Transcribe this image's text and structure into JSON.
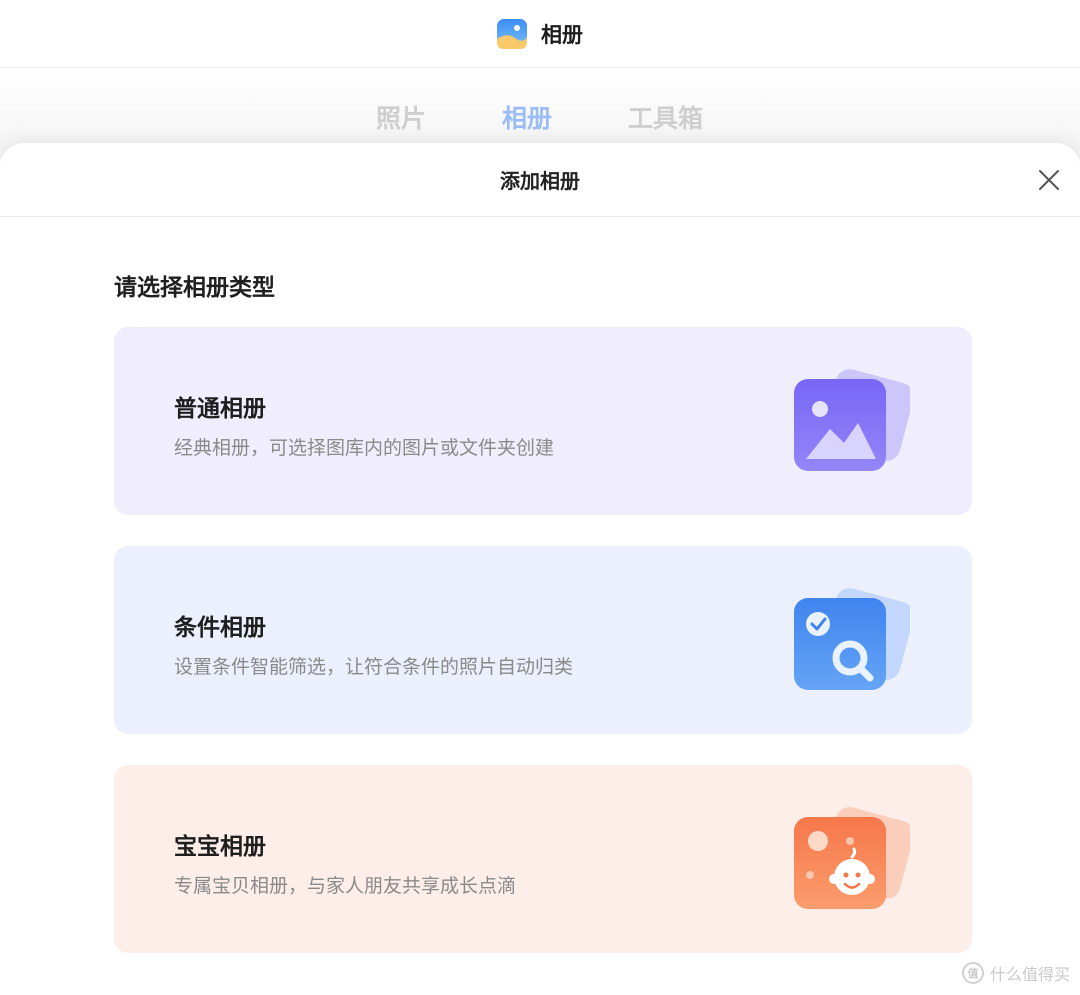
{
  "app": {
    "title": "相册",
    "icon": "gallery-app-icon"
  },
  "tabs": [
    {
      "label": "照片",
      "active": false
    },
    {
      "label": "相册",
      "active": true
    },
    {
      "label": "工具箱",
      "active": false
    }
  ],
  "sheet": {
    "title": "添加相册",
    "close_icon": "close-icon",
    "heading": "请选择相册类型",
    "cards": [
      {
        "title": "普通相册",
        "desc": "经典相册，可选择图库内的图片或文件夹创建",
        "icon": "image-album-icon",
        "accent": "#7b6cf6"
      },
      {
        "title": "条件相册",
        "desc": "设置条件智能筛选，让符合条件的照片自动归类",
        "icon": "smart-search-album-icon",
        "accent": "#4a8ef2"
      },
      {
        "title": "宝宝相册",
        "desc": "专属宝贝相册，与家人朋友共享成长点滴",
        "icon": "baby-album-icon",
        "accent": "#f57e4f"
      }
    ]
  },
  "watermark": {
    "text": "什么值得买",
    "badge": "值"
  }
}
